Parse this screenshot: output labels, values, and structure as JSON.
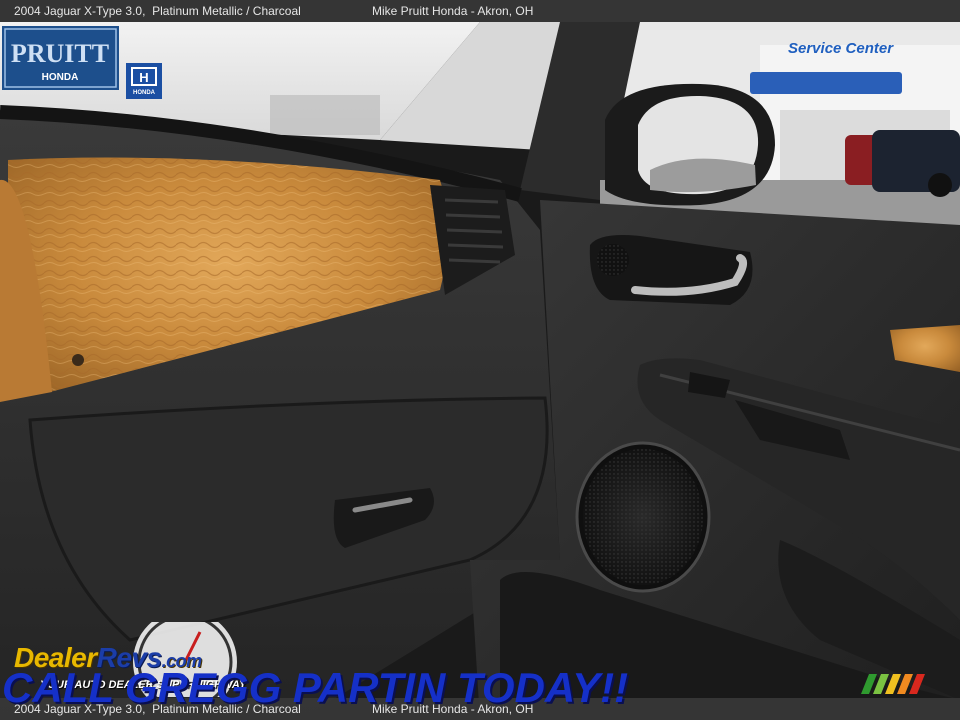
{
  "caption": {
    "vehicle": "2004 Jaguar X-Type 3.0,",
    "color": "Platinum Metallic / Charcoal",
    "dealer": "Mike Pruitt Honda - Akron, OH"
  },
  "logos": {
    "dealer_logo_text": "PRUITT",
    "dealer_logo_sub": "HONDA",
    "honda_badge": "HONDA",
    "service_center_sign": "Service Center",
    "dealerrevs_name_a": "Dealer",
    "dealerrevs_name_b": "Revs",
    "dealerrevs_domain": ".com",
    "dealerrevs_tagline": "YOUR AUTO DEALER SUPERHIGHWAY"
  },
  "banner": {
    "text": "CALL GREGG PARTIN TODAY!!"
  },
  "colors": {
    "caption_bar": "#373737",
    "wood_trim": "#c98a3c",
    "dash_charcoal": "#2e2e2e",
    "banner_blue": "#1530c8",
    "dealerrevs_gold": "#e8b800"
  }
}
